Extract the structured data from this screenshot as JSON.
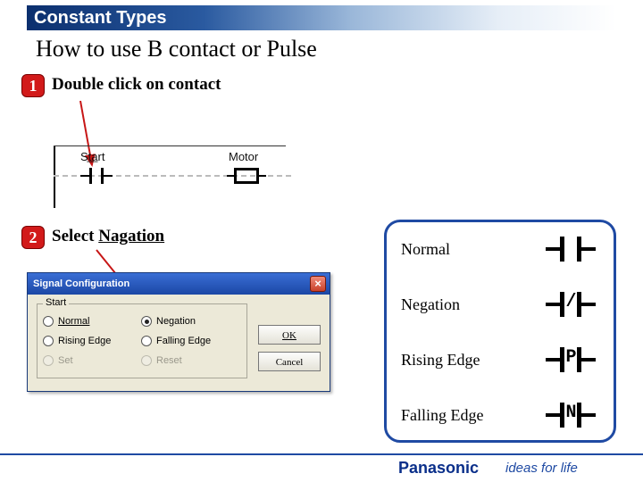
{
  "header": {
    "title": "Constant Types"
  },
  "subtitle": "How to use B contact or Pulse",
  "steps": {
    "s1": {
      "num": "1",
      "text": "Double click on contact"
    },
    "s2": {
      "num": "2",
      "pre": "Select ",
      "em": "Nagation"
    }
  },
  "ladder": {
    "left_label": "St̲a̲rt",
    "right_label": "Motor"
  },
  "dialog": {
    "title": "Signal Configuration",
    "group_legend": "Start",
    "options": {
      "normal": "Normal",
      "negation": "Negation",
      "rising": "Rising Edge",
      "falling": "Falling Edge",
      "set": "Set",
      "reset": "Reset"
    },
    "buttons": {
      "ok": "OK",
      "cancel": "Cancel"
    }
  },
  "types": {
    "normal": "Normal",
    "negation": "Negation",
    "rising": "Rising Edge",
    "falling": "Falling Edge"
  },
  "footer": {
    "brand": "Panasonic",
    "tag": "ideas for life"
  }
}
